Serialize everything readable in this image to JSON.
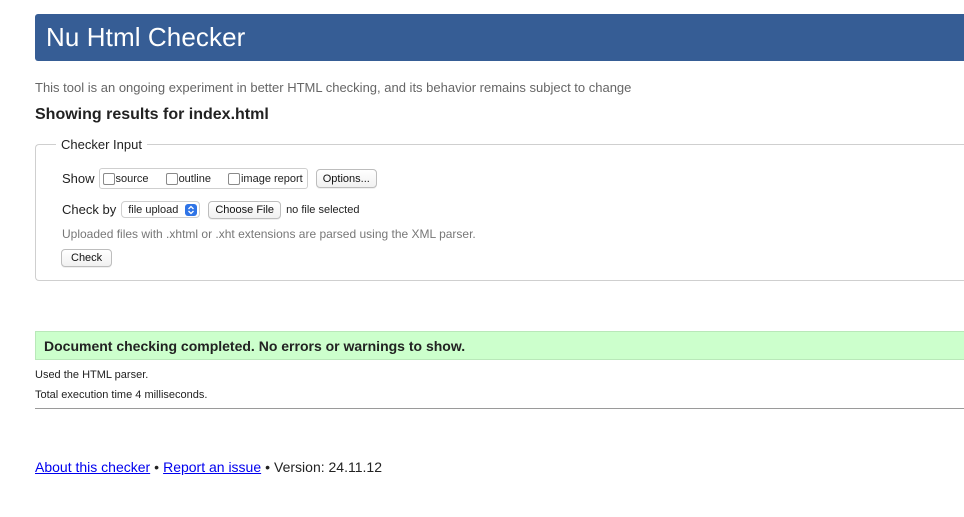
{
  "header": {
    "title": "Nu Html Checker"
  },
  "subtitle": "This tool is an ongoing experiment in better HTML checking, and its behavior remains subject to change",
  "results_heading": "Showing results for index.html",
  "checker_input": {
    "legend": "Checker Input",
    "show_label": "Show",
    "show_options": [
      {
        "label": "source",
        "checked": false
      },
      {
        "label": "outline",
        "checked": false
      },
      {
        "label": "image report",
        "checked": false
      }
    ],
    "options_button": "Options...",
    "check_by_label": "Check by",
    "check_by_selected": "file upload",
    "choose_file_button": "Choose File",
    "file_status": "no file selected",
    "note": "Uploaded files with .xhtml or .xht extensions are parsed using the XML parser.",
    "check_button": "Check"
  },
  "result": {
    "message": "Document checking completed. No errors or warnings to show.",
    "parser_note": "Used the HTML parser.",
    "execution_time": "Total execution time 4 milliseconds."
  },
  "footer": {
    "about_link": "About this checker",
    "separator": "•",
    "report_link": "Report an issue",
    "version": "Version: 24.11.12"
  },
  "colors": {
    "banner": "#365d95",
    "success_bg": "#ccffcc",
    "link": "#0000ee",
    "select_accent": "#2f74e6"
  }
}
